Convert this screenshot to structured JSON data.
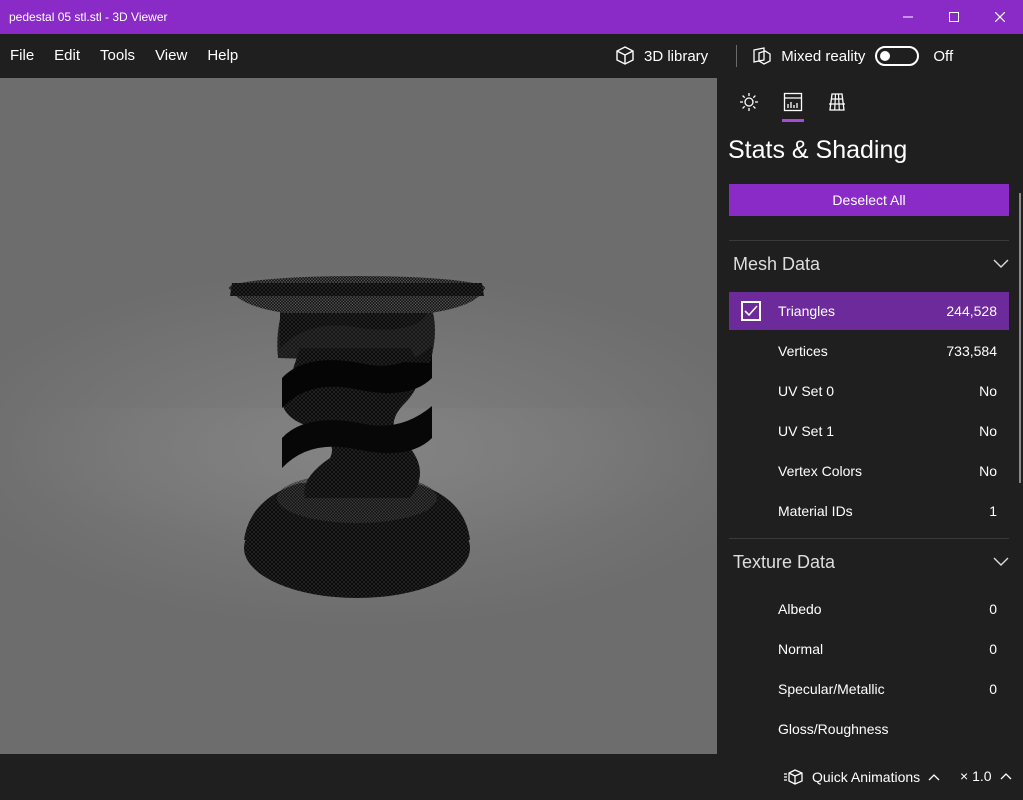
{
  "window": {
    "title": "pedestal 05  stl.stl - 3D Viewer"
  },
  "menu": [
    "File",
    "Edit",
    "Tools",
    "View",
    "Help"
  ],
  "toolbar": {
    "library_label": "3D library",
    "mixed_reality_label": "Mixed reality",
    "toggle_state": "Off"
  },
  "panel": {
    "title": "Stats & Shading",
    "deselect_label": "Deselect All",
    "mesh": {
      "heading": "Mesh Data",
      "rows": [
        {
          "name": "Triangles",
          "value": "244,528",
          "checked": true
        },
        {
          "name": "Vertices",
          "value": "733,584"
        },
        {
          "name": "UV Set 0",
          "value": "No"
        },
        {
          "name": "UV Set 1",
          "value": "No"
        },
        {
          "name": "Vertex Colors",
          "value": "No"
        },
        {
          "name": "Material IDs",
          "value": "1"
        }
      ]
    },
    "texture": {
      "heading": "Texture Data",
      "rows": [
        {
          "name": "Albedo",
          "value": "0"
        },
        {
          "name": "Normal",
          "value": "0"
        },
        {
          "name": "Specular/Metallic",
          "value": "0"
        },
        {
          "name": "Gloss/Roughness",
          "value": ""
        }
      ]
    }
  },
  "bottom": {
    "animations_label": "Quick Animations",
    "speed_label": "× 1.0"
  },
  "colors": {
    "accent": "#8a2bc8",
    "selected_row": "#6c2a9a",
    "panel_bg": "#1f1f1f"
  }
}
